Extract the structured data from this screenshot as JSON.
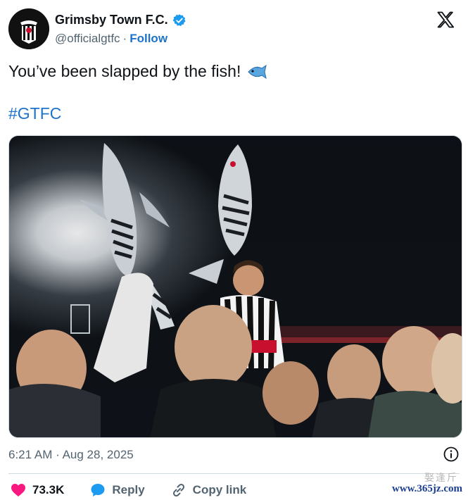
{
  "header": {
    "name": "Grimsby Town F.C.",
    "handle": "@officialgtfc",
    "separator": "·",
    "follow_label": "Follow",
    "verified": true
  },
  "tweet": {
    "text": "You’ve been slapped by the fish!",
    "emoji_icon": "fish-icon",
    "hashtag": "#GTFC"
  },
  "meta": {
    "time": "6:21 AM",
    "separator": "·",
    "date": "Aug 28, 2025"
  },
  "actions": {
    "likes": "73.3K",
    "reply_label": "Reply",
    "copy_label": "Copy link"
  },
  "watermark": {
    "site": "www.365jz.com",
    "top_text": "娶逢斤"
  },
  "colors": {
    "accent": "#1d9bf0",
    "link": "#1d73c9",
    "like": "#f91880",
    "muted": "#536471"
  }
}
